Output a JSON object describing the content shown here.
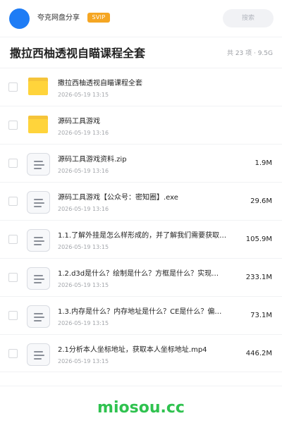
{
  "header": {
    "share_name": "夸克网盘分享",
    "badge": "SVIP",
    "search_placeholder": "搜索"
  },
  "folder": {
    "title": "撒拉西柚透视自瞄课程全套",
    "summary": "共 23 项 · 9.5G"
  },
  "files": [
    {
      "type": "folder",
      "name": "撒拉西柚透视自瞄课程全套",
      "date": "2026-05-19 13:15",
      "size": ""
    },
    {
      "type": "folder",
      "name": "源码工具游戏",
      "date": "2026-05-19 13:16",
      "size": ""
    },
    {
      "type": "file",
      "name": "源码工具游戏资料.zip",
      "date": "2026-05-19 13:16",
      "size": "1.9M"
    },
    {
      "type": "file",
      "name": "源码工具游戏【公众号：密知圈】.exe",
      "date": "2026-05-19 13:16",
      "size": "29.6M"
    },
    {
      "type": "file",
      "name": "1.1.了解外挂是怎么样形成的，并了解我们需要获取…",
      "date": "2026-05-19 13:15",
      "size": "105.9M"
    },
    {
      "type": "file",
      "name": "1.2.d3d是什么？绘制是什么？方框是什么？实现…",
      "date": "2026-05-19 13:15",
      "size": "233.1M"
    },
    {
      "type": "file",
      "name": "1.3.内存是什么？内存地址是什么？CE是什么？偏…",
      "date": "2026-05-19 13:15",
      "size": "73.1M"
    },
    {
      "type": "file",
      "name": "2.1分析本人坐标地址，获取本人坐标地址.mp4",
      "date": "2026-05-19 13:15",
      "size": "446.2M"
    }
  ],
  "watermark": "miosou.cc",
  "colors": {
    "accent": "#1e7cf5",
    "svip": "#f5a623",
    "folder": "#ffd43b",
    "watermark": "#2fc24f"
  }
}
